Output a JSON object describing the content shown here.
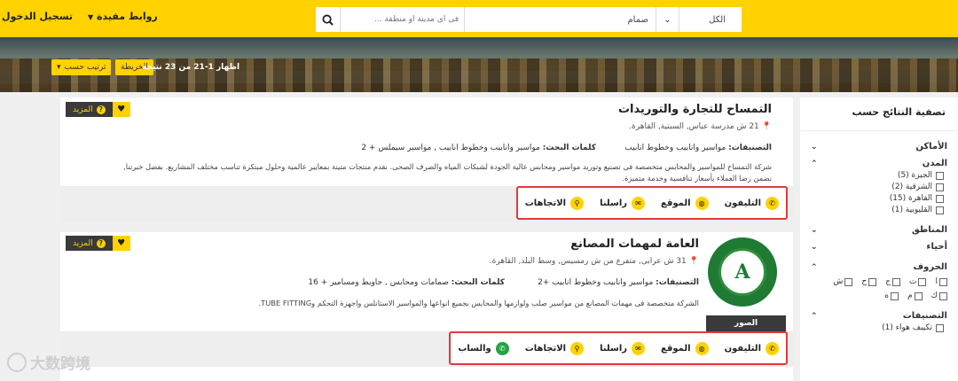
{
  "header": {
    "login": "تسجيل الدخول",
    "useful_links": "روابط مفيدة",
    "search": {
      "placeholder": "... فى اى مدينة أو منطقة",
      "category_value": "صمام",
      "all_label": "الكل"
    }
  },
  "toolbar": {
    "result_count": "اظهار 1-21 من 23 نتيجة",
    "map_button": "الخريطة",
    "sort_button": "ترتيب حسب"
  },
  "sidebar": {
    "title": "تصفية النتائج حسب",
    "places": "الأماكن",
    "cities": "المدن",
    "city_items": [
      "الجيزة (5)",
      "الشرقية (2)",
      "القاهرة (15)",
      "القليوبية (1)"
    ],
    "areas": "المناطق",
    "districts": "أحياء",
    "letters_title": "الحروف",
    "letters_row1": [
      "ا",
      "ت",
      "ج",
      "ح",
      "ش"
    ],
    "letters_row2": [
      "ك",
      "م",
      "ه"
    ],
    "classifications": "التصنيفات",
    "class_items": [
      "تكييف هواء (1)"
    ]
  },
  "listings": [
    {
      "title": "التمساح للتجارة والتوريدات",
      "address": "21 ش مدرسة عباس, السبتية, القاهرة.",
      "classifications_label": "التصنيفات:",
      "classifications": "مواسير وانابيب وخطوط انابيب",
      "keywords_label": "كلمات البحث:",
      "keywords": "مواسير وانابيب وخطوط انابيب , مواسير سيملس + 2",
      "description_1": "شركة التمساح للمواسير والمحابس متخصصة فى تصنيع وتوريد مواسير ومحابس عالية الجودة لشبكات المياه والصرف الصحى. نقدم منتجات متينة بمعايير عالمية وحلول مبتكرة تناسب مختلف المشاريع. بفضل خبرتنا,",
      "description_2": "نضمن رضا العملاء بأسعار تنافسية وخدمة متميزة.",
      "more": "المزيد",
      "actions": [
        "التليفون",
        "الموقع",
        "راسلنا",
        "الاتجاهات"
      ]
    },
    {
      "title": "العامة لمهمات المصانع",
      "address": "31 ش عرابى, متفرع من ش رمسيس, وسط البلد, القاهرة.",
      "classifications_label": "التصنيفات:",
      "classifications": "مواسير وانابيب وخطوط انابيب +2",
      "keywords_label": "كلمات البحث:",
      "keywords": "صمامات ومحابس , جاويط ومسامير + 16",
      "description_1": "الشركة متخصصة فى مهمات المصانع من مواسير صلب ولوازمها والمحابس بجميع انواعها والمواسير الاستانلس واجهزة التحكم وTUBE FITTING.",
      "logo_letter": "A",
      "photos": "الصور",
      "more": "المزيد",
      "actions": [
        "التليفون",
        "الموقع",
        "راسلنا",
        "الاتجاهات",
        "والساب"
      ]
    }
  ],
  "watermark": "大数跨境"
}
